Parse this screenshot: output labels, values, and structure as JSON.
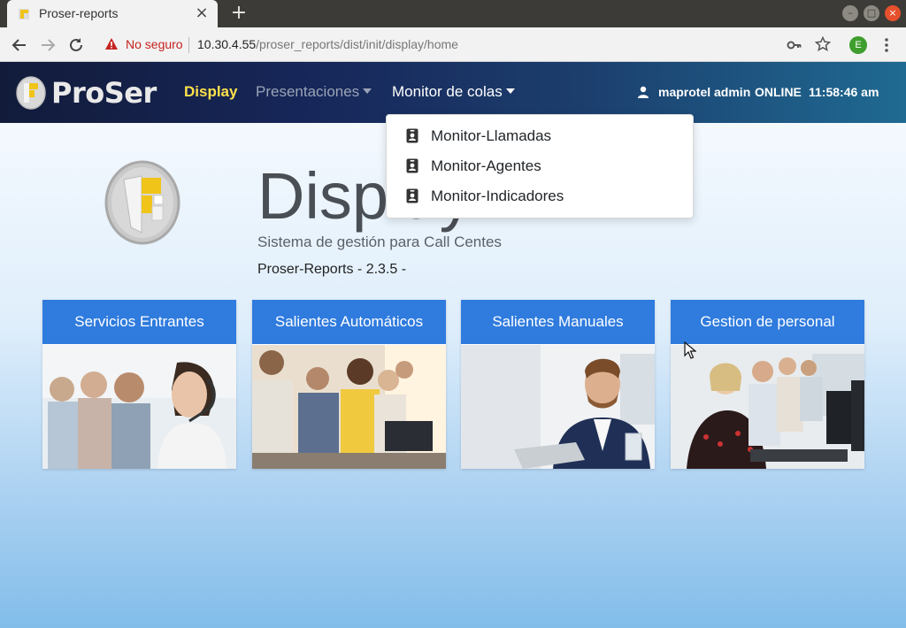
{
  "browser": {
    "tab_title": "Proser-reports",
    "tab_close": "×",
    "new_tab": "+",
    "security_label": "No seguro",
    "url_host": "10.30.4.55",
    "url_path": "/proser_reports/dist/init/display/home",
    "profile_initial": "E"
  },
  "nav": {
    "logo_text": "ProSer",
    "display": "Display",
    "presentaciones": "Presentaciones",
    "monitor": "Monitor de colas",
    "user_name": "maprotel admin",
    "user_status": "ONLINE",
    "time": "11:58:46 am",
    "display_color": "#ffe24a"
  },
  "dropdown": {
    "items": [
      {
        "label": "Monitor-Llamadas",
        "icon": "id-badge-icon"
      },
      {
        "label": "Monitor-Agentes",
        "icon": "id-badge-icon"
      },
      {
        "label": "Monitor-Indicadores",
        "icon": "id-badge-icon"
      }
    ]
  },
  "hero": {
    "title": "Display",
    "subtitle": "Sistema de gestión para Call Centes",
    "version": "Proser-Reports - 2.3.5 -"
  },
  "cards": [
    {
      "title": "Servicios Entrantes"
    },
    {
      "title": "Salientes Automáticos"
    },
    {
      "title": "Salientes Manuales"
    },
    {
      "title": "Gestion de personal"
    }
  ],
  "colors": {
    "card_header": "#2f7bde",
    "security_warning": "#c5221f"
  }
}
